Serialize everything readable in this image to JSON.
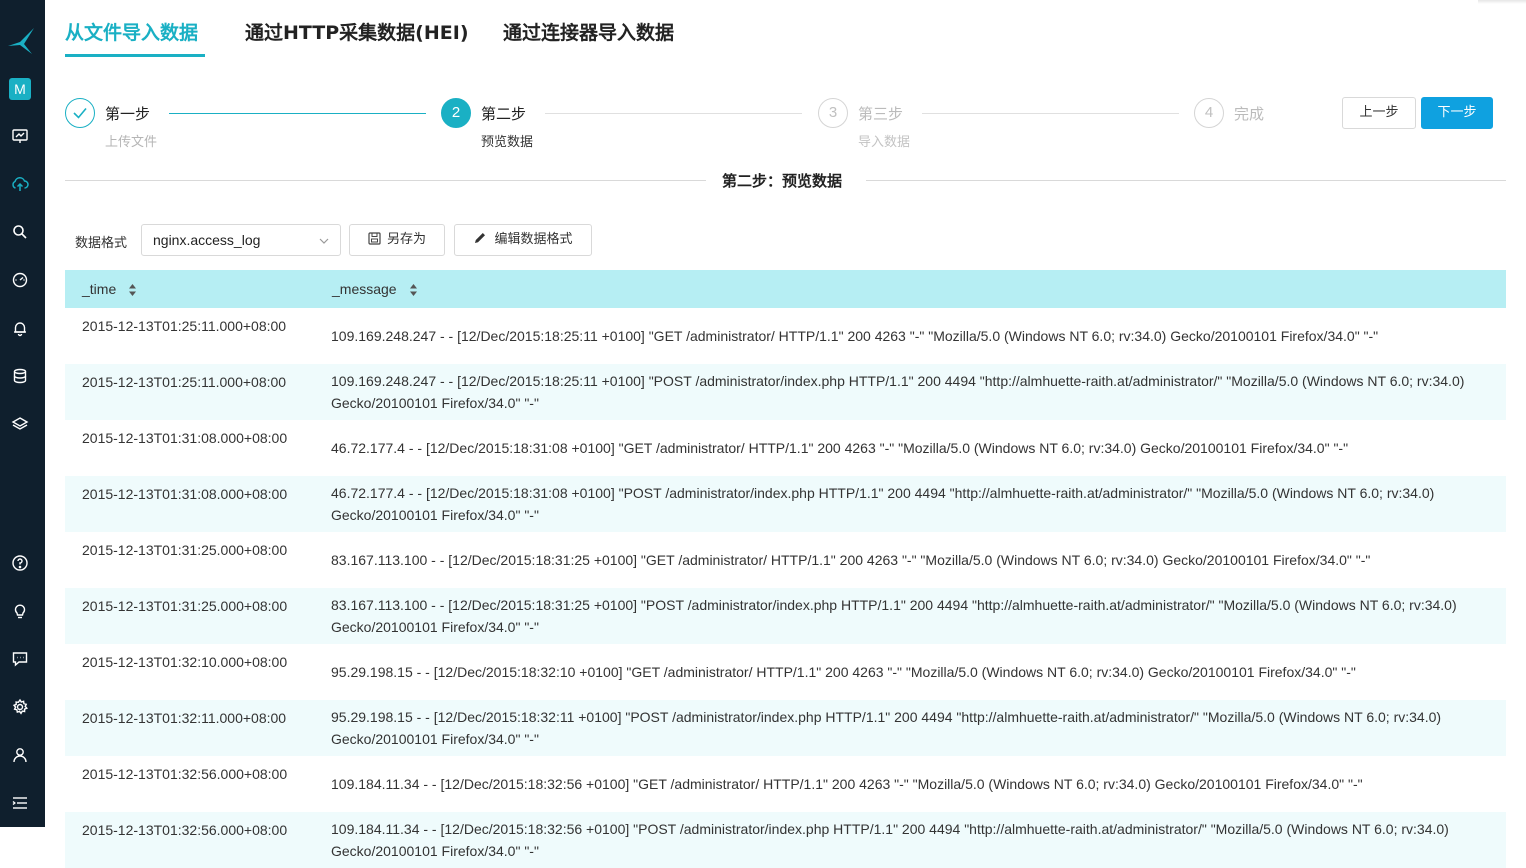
{
  "nav": {
    "workspace_badge": "M",
    "items": [
      "dashboard-icon",
      "upload-cloud-icon",
      "search-icon",
      "gauge-icon",
      "bell-icon",
      "database-icon",
      "layers-icon",
      "help-icon",
      "lightbulb-icon",
      "chat-icon",
      "gear-icon",
      "user-icon",
      "menu-list-icon"
    ]
  },
  "tabs": [
    {
      "label": "从文件导入数据",
      "active": true
    },
    {
      "label": "通过HTTP采集数据(HEI)",
      "active": false
    },
    {
      "label": "通过连接器导入数据",
      "active": false
    }
  ],
  "steps": [
    {
      "number": "1",
      "title": "第一步",
      "subtitle": "上传文件",
      "status": "done"
    },
    {
      "number": "2",
      "title": "第二步",
      "subtitle": "预览数据",
      "status": "current"
    },
    {
      "number": "3",
      "title": "第三步",
      "subtitle": "导入数据",
      "status": "todo"
    },
    {
      "number": "4",
      "title": "完成",
      "subtitle": "",
      "status": "todo"
    }
  ],
  "buttons": {
    "prev": "上一步",
    "next": "下一步"
  },
  "section_title": "第二步：预览数据",
  "toolbar": {
    "format_label": "数据格式",
    "format_value": "nginx.access_log",
    "save_as": "另存为",
    "edit_format": "编辑数据格式"
  },
  "table": {
    "columns": [
      "_time",
      "_message"
    ],
    "rows": [
      {
        "time": "2015-12-13T01:25:11.000+08:00",
        "message": "109.169.248.247 - - [12/Dec/2015:18:25:11 +0100] \"GET /administrator/ HTTP/1.1\" 200 4263 \"-\" \"Mozilla/5.0 (Windows NT 6.0; rv:34.0) Gecko/20100101 Firefox/34.0\" \"-\""
      },
      {
        "time": "2015-12-13T01:25:11.000+08:00",
        "message": "109.169.248.247 - - [12/Dec/2015:18:25:11 +0100] \"POST /administrator/index.php HTTP/1.1\" 200 4494 \"http://almhuette-raith.at/administrator/\" \"Mozilla/5.0 (Windows NT 6.0; rv:34.0) Gecko/20100101 Firefox/34.0\" \"-\""
      },
      {
        "time": "2015-12-13T01:31:08.000+08:00",
        "message": "46.72.177.4 - - [12/Dec/2015:18:31:08 +0100] \"GET /administrator/ HTTP/1.1\" 200 4263 \"-\" \"Mozilla/5.0 (Windows NT 6.0; rv:34.0) Gecko/20100101 Firefox/34.0\" \"-\""
      },
      {
        "time": "2015-12-13T01:31:08.000+08:00",
        "message": "46.72.177.4 - - [12/Dec/2015:18:31:08 +0100] \"POST /administrator/index.php HTTP/1.1\" 200 4494 \"http://almhuette-raith.at/administrator/\" \"Mozilla/5.0 (Windows NT 6.0; rv:34.0) Gecko/20100101 Firefox/34.0\" \"-\""
      },
      {
        "time": "2015-12-13T01:31:25.000+08:00",
        "message": "83.167.113.100 - - [12/Dec/2015:18:31:25 +0100] \"GET /administrator/ HTTP/1.1\" 200 4263 \"-\" \"Mozilla/5.0 (Windows NT 6.0; rv:34.0) Gecko/20100101 Firefox/34.0\" \"-\""
      },
      {
        "time": "2015-12-13T01:31:25.000+08:00",
        "message": "83.167.113.100 - - [12/Dec/2015:18:31:25 +0100] \"POST /administrator/index.php HTTP/1.1\" 200 4494 \"http://almhuette-raith.at/administrator/\" \"Mozilla/5.0 (Windows NT 6.0; rv:34.0) Gecko/20100101 Firefox/34.0\" \"-\""
      },
      {
        "time": "2015-12-13T01:32:10.000+08:00",
        "message": "95.29.198.15 - - [12/Dec/2015:18:32:10 +0100] \"GET /administrator/ HTTP/1.1\" 200 4263 \"-\" \"Mozilla/5.0 (Windows NT 6.0; rv:34.0) Gecko/20100101 Firefox/34.0\" \"-\""
      },
      {
        "time": "2015-12-13T01:32:11.000+08:00",
        "message": "95.29.198.15 - - [12/Dec/2015:18:32:11 +0100] \"POST /administrator/index.php HTTP/1.1\" 200 4494 \"http://almhuette-raith.at/administrator/\" \"Mozilla/5.0 (Windows NT 6.0; rv:34.0) Gecko/20100101 Firefox/34.0\" \"-\""
      },
      {
        "time": "2015-12-13T01:32:56.000+08:00",
        "message": "109.184.11.34 - - [12/Dec/2015:18:32:56 +0100] \"GET /administrator/ HTTP/1.1\" 200 4263 \"-\" \"Mozilla/5.0 (Windows NT 6.0; rv:34.0) Gecko/20100101 Firefox/34.0\" \"-\""
      },
      {
        "time": "2015-12-13T01:32:56.000+08:00",
        "message": "109.184.11.34 - - [12/Dec/2015:18:32:56 +0100] \"POST /administrator/index.php HTTP/1.1\" 200 4494 \"http://almhuette-raith.at/administrator/\" \"Mozilla/5.0 (Windows NT 6.0; rv:34.0) Gecko/20100101 Firefox/34.0\" \"-\""
      }
    ]
  },
  "colors": {
    "accent": "#1ab0c4",
    "primary_button": "#0fa1e0",
    "sidebar_bg": "#0f1f2d",
    "table_header_bg": "#b6eef3",
    "row_stripe": "#effbfc"
  }
}
